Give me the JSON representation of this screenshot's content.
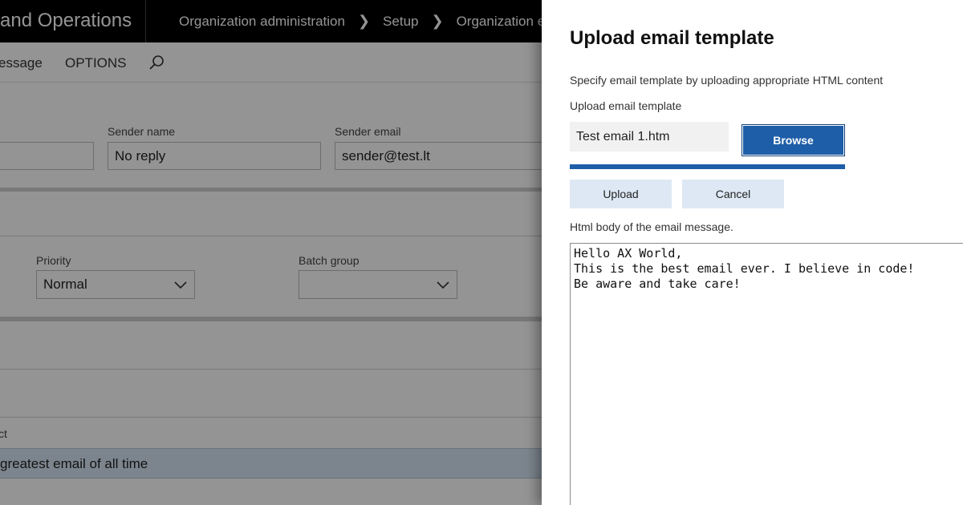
{
  "background": {
    "app_title": "and Operations",
    "breadcrumb": [
      "Organization administration",
      "Setup",
      "Organization en"
    ],
    "actions": [
      "essage",
      "OPTIONS"
    ],
    "fields": {
      "sender_name_label": "Sender name",
      "sender_name_value": "No reply",
      "sender_email_label": "Sender email",
      "sender_email_value": "sender@test.lt",
      "priority_label": "Priority",
      "priority_value": "Normal",
      "batch_group_label": "Batch group",
      "batch_group_value": ""
    },
    "list_header": "ct",
    "selected_row": "greatest email of all time"
  },
  "panel": {
    "title": "Upload email template",
    "description": "Specify email template by uploading appropriate HTML content",
    "upload_label": "Upload email template",
    "file_name": "Test email 1.htm",
    "browse_label": "Browse",
    "upload_progress_percent": 100,
    "upload_button": "Upload",
    "cancel_button": "Cancel",
    "body_label": "Html body of the email message.",
    "body_lines": [
      "Hello AX World,",
      "This is the best email ever. I believe in code!",
      "Be aware and take care!"
    ]
  },
  "colors": {
    "accent": "#1e5ea8",
    "light_button": "#dde8f4",
    "topbar": "#000000"
  },
  "icons": {
    "search": "search-icon",
    "breadcrumb_separator": "chevron-right-icon",
    "dropdown": "chevron-down-icon"
  }
}
